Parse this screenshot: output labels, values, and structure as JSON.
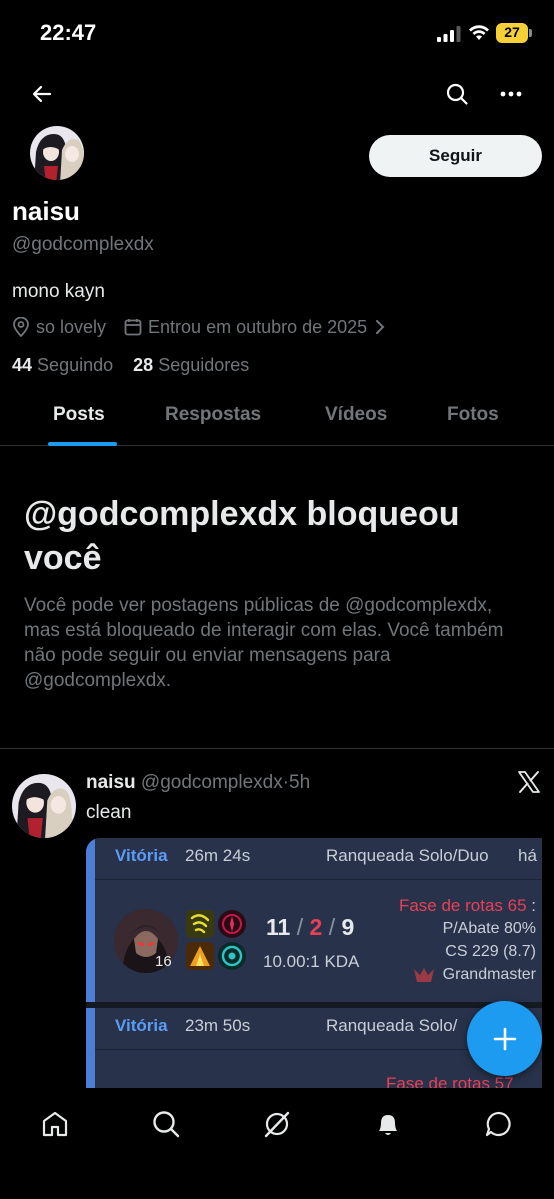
{
  "status_bar": {
    "time": "22:47",
    "battery": "27"
  },
  "profile": {
    "name": "naisu",
    "handle": "@godcomplexdx",
    "bio": "mono kayn",
    "location": "so lovely",
    "joined": "Entrou em outubro de 2025",
    "following_count": "44",
    "following_label": "Seguindo",
    "followers_count": "28",
    "followers_label": "Seguidores",
    "follow_button": "Seguir"
  },
  "tabs": [
    "Posts",
    "Respostas",
    "Vídeos",
    "Fotos"
  ],
  "blocked": {
    "title": "@godcomplexdx bloqueou você",
    "description": "Você pode ver postagens públicas de @godcomplexdx, mas está bloqueado de interagir com elas. Você também não pode seguir ou enviar mensagens para @godcomplexdx."
  },
  "post": {
    "name": "naisu",
    "handle": "@godcomplexdx",
    "sep": "·",
    "time": "5h",
    "text": "clean"
  },
  "matches": [
    {
      "result": "Vitória",
      "duration": "26m 24s",
      "queue": "Ranqueada Solo/Duo",
      "ago": "há",
      "level": "16",
      "kills": "11",
      "deaths": "2",
      "assists": "9",
      "kda_ratio": "10.00:1 KDA",
      "lane_phase": "Fase de rotas 65",
      "kill_participation": "P/Abate 80%",
      "cs": "CS 229 (8.7)",
      "rank": "Grandmaster"
    },
    {
      "result": "Vitória",
      "duration": "23m 50s",
      "queue": "Ranqueada Solo/",
      "lane_phase": "Fase de rotas 57"
    }
  ],
  "colors": {
    "accent": "#1d9bf0",
    "win": "#5b9cf5",
    "death": "#e84057",
    "muted": "#71767b"
  },
  "icons": {
    "nav": [
      "home-icon",
      "explore-icon",
      "grok-icon",
      "notifications-icon",
      "messages-icon"
    ]
  }
}
